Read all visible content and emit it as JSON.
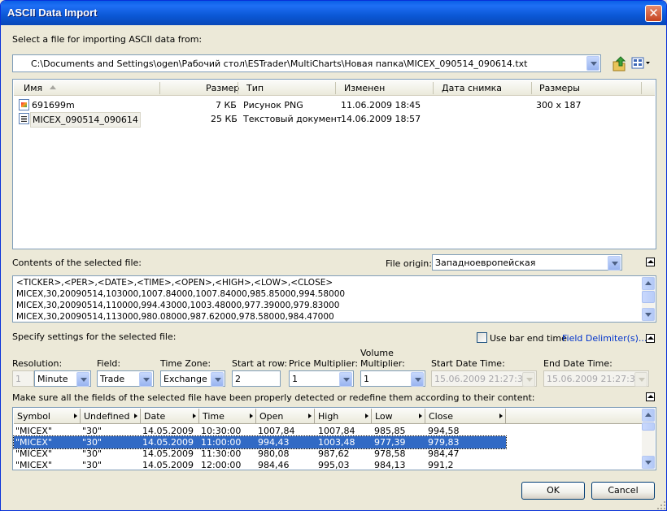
{
  "window": {
    "title": "ASCII Data Import",
    "close_label": "✕"
  },
  "file_select": {
    "label": "Select a file for importing ASCII data from:",
    "path": "C:\\Documents and Settings\\ogen\\Рабочий стол\\ESTrader\\MultiCharts\\Новая папка\\MICEX_090514_090614.txt"
  },
  "file_list": {
    "columns": [
      "Имя",
      "Размер",
      "Тип",
      "Изменен",
      "Дата снимка",
      "Размеры"
    ],
    "rows": [
      {
        "name": "691699m",
        "size": "7 КБ",
        "type": "Рисунок PNG",
        "modified": "11.06.2009 18:45",
        "snapshot": "",
        "dimensions": "300 x 187",
        "icon": "png-file-icon"
      },
      {
        "name": "MICEX_090514_090614",
        "size": "25 КБ",
        "type": "Текстовый документ",
        "modified": "14.06.2009 18:57",
        "snapshot": "",
        "dimensions": "",
        "icon": "text-file-icon"
      }
    ]
  },
  "contents": {
    "label": "Contents of the selected file:",
    "origin_label": "File origin:",
    "origin_value": "Западноевропейская",
    "lines": [
      "<TICKER>,<PER>,<DATE>,<TIME>,<OPEN>,<HIGH>,<LOW>,<CLOSE>",
      "MICEX,30,20090514,103000,1007.84000,1007.84000,985.85000,994.58000",
      "MICEX,30,20090514,110000,994.43000,1003.48000,977.39000,979.83000",
      "MICEX,30,20090514,113000,980.08000,987.62000,978.58000,984.47000"
    ]
  },
  "settings": {
    "label": "Specify settings for the selected file:",
    "use_bar_end_time": "Use bar end time",
    "field_delimiter": "Field Delimiter(s)...",
    "resolution_label": "Resolution:",
    "resolution_value": "1",
    "resolution_unit": "Minute",
    "field_label": "Field:",
    "field_value": "Trade",
    "timezone_label": "Time Zone:",
    "timezone_value": "Exchange",
    "start_row_label": "Start at row:",
    "start_row_value": "2",
    "price_mult_label": "Price Multiplier:",
    "price_mult_value": "1",
    "volume_mult_label_1": "Volume",
    "volume_mult_label_2": "Multiplier:",
    "volume_mult_value": "1",
    "start_dt_label": "Start Date Time:",
    "start_dt_value": "15.06.2009 21:27:30",
    "end_dt_label": "End Date Time:",
    "end_dt_value": "15.06.2009 21:27:30"
  },
  "fields_grid": {
    "label": "Make sure all the fields of the selected file have been properly detected or redefine them according to their content:",
    "columns": [
      "Symbol",
      "Undefined",
      "Date",
      "Time",
      "Open",
      "High",
      "Low",
      "Close"
    ],
    "rows": [
      [
        "\"MICEX\"",
        "\"30\"",
        "14.05.2009",
        "10:30:00",
        "1007,84",
        "1007,84",
        "985,85",
        "994,58"
      ],
      [
        "\"MICEX\"",
        "\"30\"",
        "14.05.2009",
        "11:00:00",
        "994,43",
        "1003,48",
        "977,39",
        "979,83"
      ],
      [
        "\"MICEX\"",
        "\"30\"",
        "14.05.2009",
        "11:30:00",
        "980,08",
        "987,62",
        "978,58",
        "984,47"
      ],
      [
        "\"MICEX\"",
        "\"30\"",
        "14.05.2009",
        "12:00:00",
        "984,46",
        "995,03",
        "984,13",
        "991,2"
      ]
    ],
    "selected_row": 1
  },
  "buttons": {
    "ok": "OK",
    "cancel": "Cancel"
  },
  "colors": {
    "title_bar": "#0a5fe6",
    "selection": "#316ac5",
    "link": "#0033cc",
    "face": "#ece9d8"
  }
}
